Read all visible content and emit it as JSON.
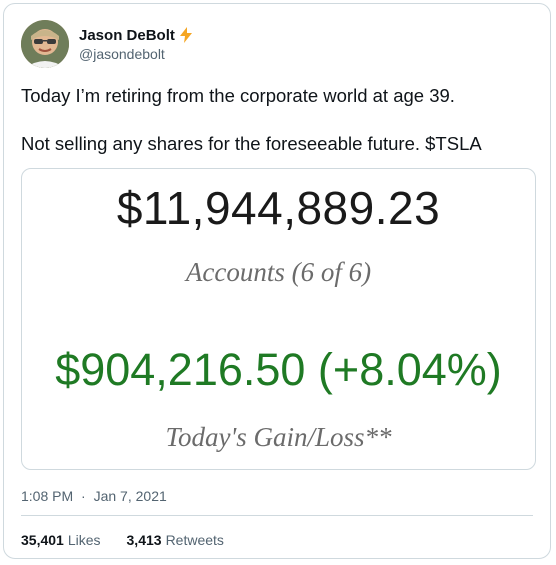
{
  "author": {
    "display_name": "Jason DeBolt",
    "handle": "@jasondebolt",
    "badge_icon": "lightning-bolt-icon",
    "badge_color": "#f5a623"
  },
  "tweet": {
    "line1": "Today I’m retiring from the corporate world at age 39.",
    "line2": "Not selling any shares for the foreseeable future. $TSLA"
  },
  "media": {
    "balance": "$11,944,889.23",
    "accounts_label": "Accounts (6 of 6)",
    "gain": "$904,216.50 (+8.04%)",
    "gain_label": "Today's Gain/Loss**",
    "gain_color": "#1f7a24"
  },
  "meta": {
    "time": "1:08 PM",
    "separator": "·",
    "date": "Jan 7, 2021"
  },
  "stats": {
    "likes_count": "35,401",
    "likes_label": "Likes",
    "retweets_count": "3,413",
    "retweets_label": "Retweets"
  }
}
